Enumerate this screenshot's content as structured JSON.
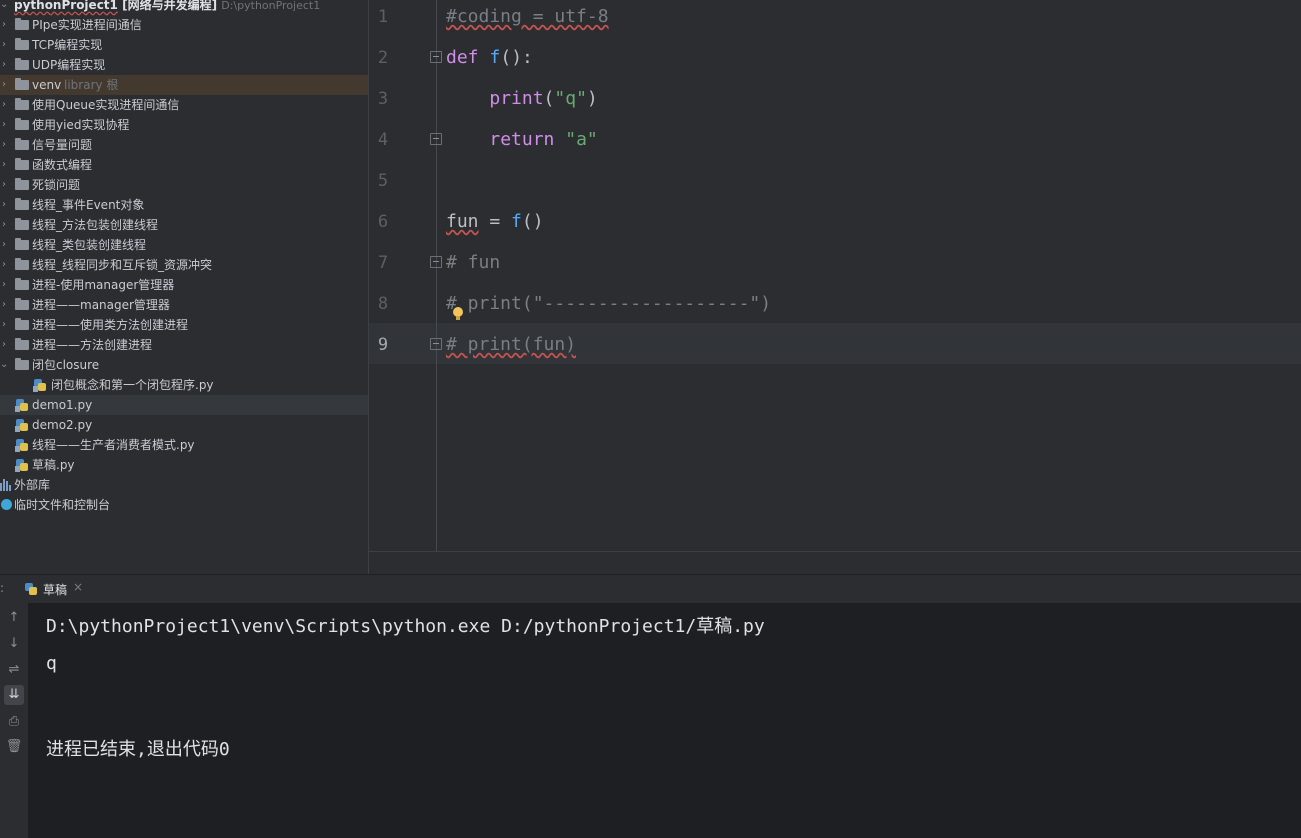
{
  "project": {
    "root_name": "pythonProject1",
    "root_module": "[网络与并发编程]",
    "root_path": "D:\\pythonProject1",
    "items": [
      {
        "label": "PIpe实现进程间通信",
        "type": "folder"
      },
      {
        "label": "TCP编程实现",
        "type": "folder"
      },
      {
        "label": "UDP编程实现",
        "type": "folder"
      },
      {
        "label": "venv",
        "hint": "library 根",
        "type": "folder"
      },
      {
        "label": "使用Queue实现进程间通信",
        "type": "folder"
      },
      {
        "label": "使用yied实现协程",
        "type": "folder"
      },
      {
        "label": "信号量问题",
        "type": "folder"
      },
      {
        "label": "函数式编程",
        "type": "folder"
      },
      {
        "label": "死锁问题",
        "type": "folder"
      },
      {
        "label": "线程_事件Event对象",
        "type": "folder"
      },
      {
        "label": "线程_方法包装创建线程",
        "type": "folder"
      },
      {
        "label": "线程_类包装创建线程",
        "type": "folder"
      },
      {
        "label": "线程_线程同步和互斥锁_资源冲突",
        "type": "folder"
      },
      {
        "label": "进程-使用manager管理器",
        "type": "folder"
      },
      {
        "label": "进程——manager管理器",
        "type": "folder"
      },
      {
        "label": "进程——使用类方法创建进程",
        "type": "folder"
      },
      {
        "label": "进程——方法创建进程",
        "type": "folder"
      },
      {
        "label": "闭包closure",
        "type": "folder"
      },
      {
        "label": "闭包概念和第一个闭包程序.py",
        "type": "file"
      },
      {
        "label": "demo1.py",
        "type": "file"
      },
      {
        "label": "demo2.py",
        "type": "file"
      },
      {
        "label": "线程——生产者消费者模式.py",
        "type": "file"
      },
      {
        "label": "草稿.py",
        "type": "file"
      },
      {
        "label": "外部库",
        "type": "library"
      },
      {
        "label": "临时文件和控制台",
        "type": "scratch"
      }
    ]
  },
  "editor": {
    "line_numbers": [
      "1",
      "2",
      "3",
      "4",
      "5",
      "6",
      "7",
      "8",
      "9"
    ],
    "current_line": "9",
    "lines": [
      {
        "comment": "#coding = utf-8"
      },
      {
        "kw": "def",
        "fn": "f",
        "rest": "():"
      },
      {
        "indent": "    ",
        "kw": "print",
        "p1": "(",
        "str": "\"q\"",
        "p2": ")"
      },
      {
        "indent": "    ",
        "kw": "return",
        "sp": " ",
        "str": "\"a\""
      },
      {},
      {
        "var": "fun",
        "eq": " = ",
        "fn": "f",
        "rest": "()"
      },
      {
        "comment": "# fun"
      },
      {
        "comment": "# print(\"-------------------\")"
      },
      {
        "comment": "# print(fun)"
      }
    ]
  },
  "run": {
    "tab_label": "草稿",
    "tab_close": "×",
    "header_prefix": ":",
    "output": [
      "D:\\pythonProject1\\venv\\Scripts\\python.exe D:/pythonProject1/草稿.py",
      "q",
      "",
      "进程已结束,退出代码0"
    ],
    "toolbar_icons": [
      "up-arrow-icon",
      "down-arrow-icon",
      "soft-wrap-icon",
      "scroll-to-end-icon",
      "print-icon",
      "trash-icon"
    ]
  }
}
